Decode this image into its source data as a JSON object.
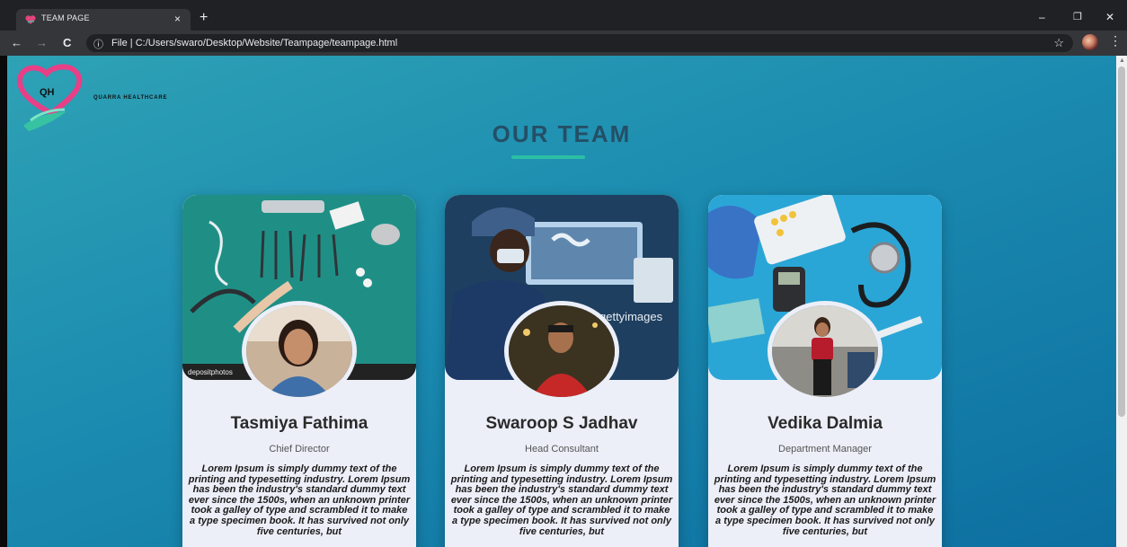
{
  "browser": {
    "tab_title": "TEAM PAGE",
    "tab_close": "×",
    "new_tab": "+",
    "url_prefix": "File",
    "url": "C:/Users/swaro/Desktop/Website/Teampage/teampage.html",
    "window_controls": {
      "minimize": "–",
      "restore": "❐",
      "close": "✕"
    },
    "nav": {
      "back": "←",
      "forward": "→",
      "reload": "C"
    }
  },
  "site": {
    "logo_text": "QH",
    "brand": "QUARRA HEALTHCARE",
    "heading": "OUR TEAM",
    "accent_color": "#2bbfa4"
  },
  "team": [
    {
      "name": "Tasmiya Fathima",
      "role": "Chief Director",
      "cover_watermark": "depositphotos",
      "description": "Lorem Ipsum is simply dummy text of the printing and typesetting industry. Lorem Ipsum has been the industry's standard dummy text ever since the 1500s, when an unknown printer took a galley of type and scrambled it to make a type specimen book. It has survived not only five centuries, but"
    },
    {
      "name": "Swaroop S Jadhav",
      "role": "Head Consultant",
      "cover_watermark": "gettyimages",
      "description": "Lorem Ipsum is simply dummy text of the printing and typesetting industry. Lorem Ipsum has been the industry's standard dummy text ever since the 1500s, when an unknown printer took a galley of type and scrambled it to make a type specimen book. It has survived not only five centuries, but"
    },
    {
      "name": "Vedika Dalmia",
      "role": "Department Manager",
      "cover_watermark": "",
      "description": "Lorem Ipsum is simply dummy text of the printing and typesetting industry. Lorem Ipsum has been the industry's standard dummy text ever since the 1500s, when an unknown printer took a galley of type and scrambled it to make a type specimen book. It has survived not only five centuries, but"
    }
  ]
}
